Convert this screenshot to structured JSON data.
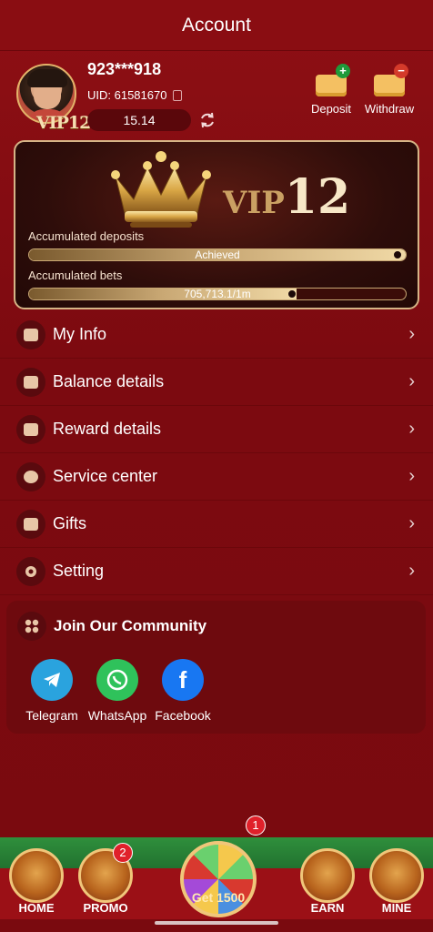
{
  "header": {
    "title": "Account"
  },
  "profile": {
    "username": "923***918",
    "uid": "UID: 61581670",
    "balance": "15.14",
    "vip_badge": "VIP12"
  },
  "actions": {
    "deposit": "Deposit",
    "withdraw": "Withdraw"
  },
  "vip_card": {
    "vip_text": "VIP",
    "vip_level": "12",
    "deposits_label": "Accumulated deposits",
    "deposits_status": "Achieved",
    "deposits_progress": 1.0,
    "bets_label": "Accumulated bets",
    "bets_status": "705,713.1/1m",
    "bets_progress": 0.71
  },
  "menu": {
    "items": [
      {
        "label": "My Info",
        "icon": "id-card-icon"
      },
      {
        "label": "Balance details",
        "icon": "wallet-icon"
      },
      {
        "label": "Reward details",
        "icon": "gift-icon"
      },
      {
        "label": "Service center",
        "icon": "headset-icon"
      },
      {
        "label": "Gifts",
        "icon": "ticket-icon"
      },
      {
        "label": "Setting",
        "icon": "gear-icon"
      }
    ]
  },
  "community": {
    "title": "Join Our Community",
    "socials": [
      {
        "label": "Telegram",
        "color": "#2aa3de"
      },
      {
        "label": "WhatsApp",
        "color": "#2fc25b"
      },
      {
        "label": "Facebook",
        "color": "#1877f2"
      }
    ]
  },
  "bottom_nav": {
    "home": "HOME",
    "promo": "PROMO",
    "promo_badge": "2",
    "spin_label": "Get 1500",
    "spin_badge": "1",
    "earn": "EARN",
    "mine": "MINE"
  }
}
